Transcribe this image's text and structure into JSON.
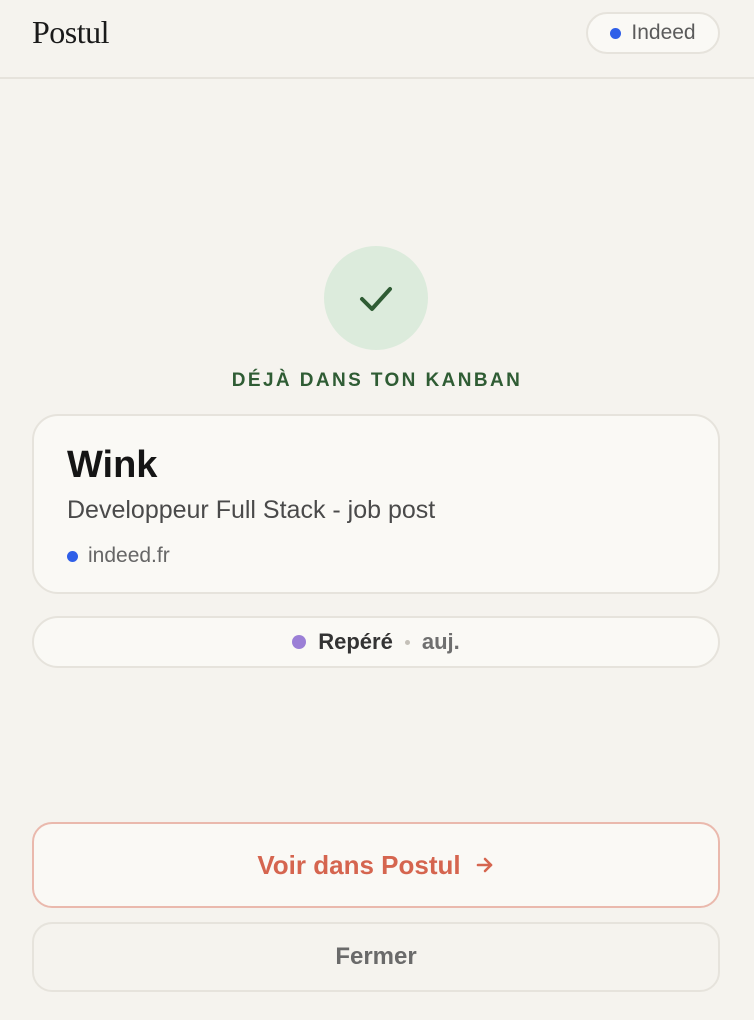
{
  "header": {
    "brand": "Postul",
    "source_label": "Indeed"
  },
  "status": {
    "heading": "DÉJÀ DANS TON KANBAN"
  },
  "job": {
    "company": "Wink",
    "title": "Developpeur Full Stack - job post",
    "domain": "indeed.fr"
  },
  "stage": {
    "label": "Repéré",
    "time": "auj."
  },
  "actions": {
    "primary_label": "Voir dans Postul",
    "secondary_label": "Fermer"
  },
  "colors": {
    "accent": "#d5654f",
    "success": "#2f5c34",
    "source_dot": "#2f5fe8",
    "stage_dot": "#9b7fd6"
  },
  "icons": {
    "check": "check-icon",
    "arrow": "arrow-right-icon"
  }
}
